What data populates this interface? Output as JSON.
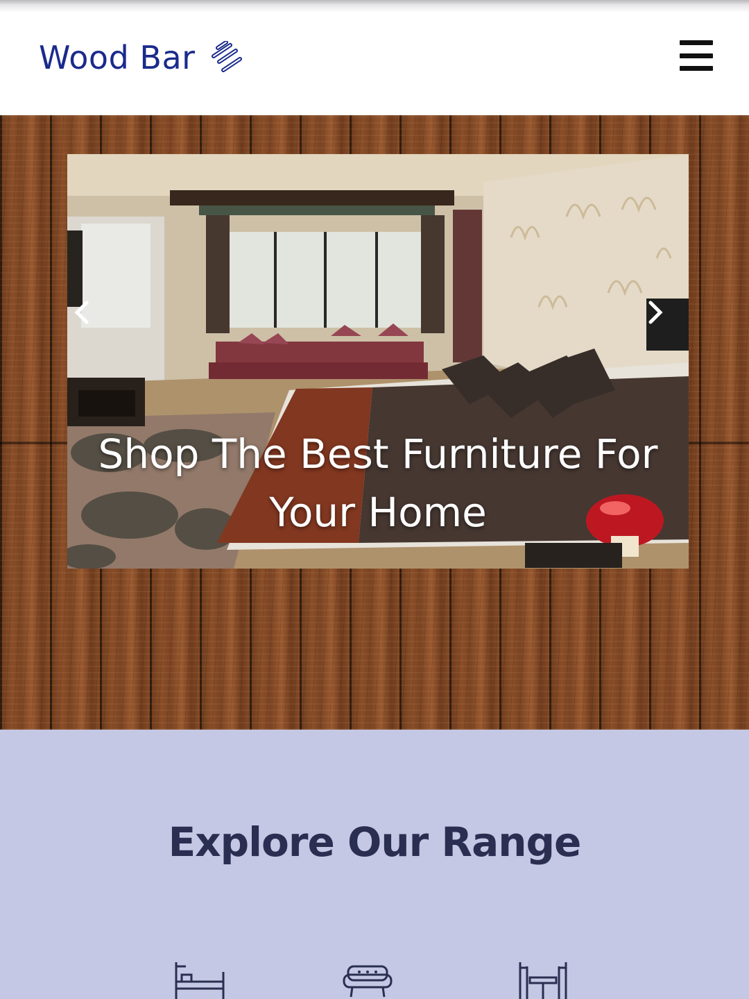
{
  "header": {
    "brand": "Wood Bar",
    "logo_icon": "squarespace-logo-icon",
    "menu_icon": "hamburger-menu-icon",
    "brand_color": "#1a2a8c"
  },
  "hero": {
    "caption_line1": "Shop The Best Furniture For",
    "caption_line2": "Your Home",
    "prev_icon": "chevron-left-icon",
    "next_icon": "chevron-right-icon"
  },
  "explore": {
    "title": "Explore Our Range",
    "background": "#c4c8e4",
    "categories": [
      {
        "icon": "bunk-bed-icon"
      },
      {
        "icon": "sofa-icon"
      },
      {
        "icon": "dining-set-icon"
      }
    ]
  }
}
